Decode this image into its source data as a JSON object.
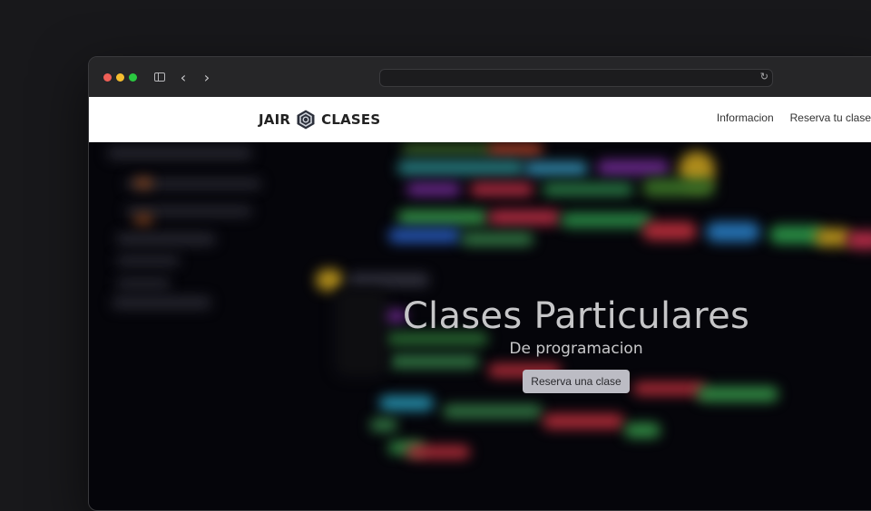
{
  "browser": {
    "address": "",
    "colors": {
      "close": "#ef5f57",
      "minimize": "#f5bd2f",
      "zoom": "#2ac840"
    }
  },
  "navbar": {
    "brand_left": "JAIR",
    "brand_right": "CLASES",
    "links": [
      "Informacion",
      "Reserva tu clase"
    ]
  },
  "hero": {
    "title": "Clases Particulares",
    "subtitle": "De programacion",
    "button": "Reserva una clase"
  },
  "icons": [
    "sidebar-toggle-icon",
    "chevron-left-icon",
    "chevron-right-icon",
    "reload-icon",
    "hexagon-logo-icon"
  ]
}
